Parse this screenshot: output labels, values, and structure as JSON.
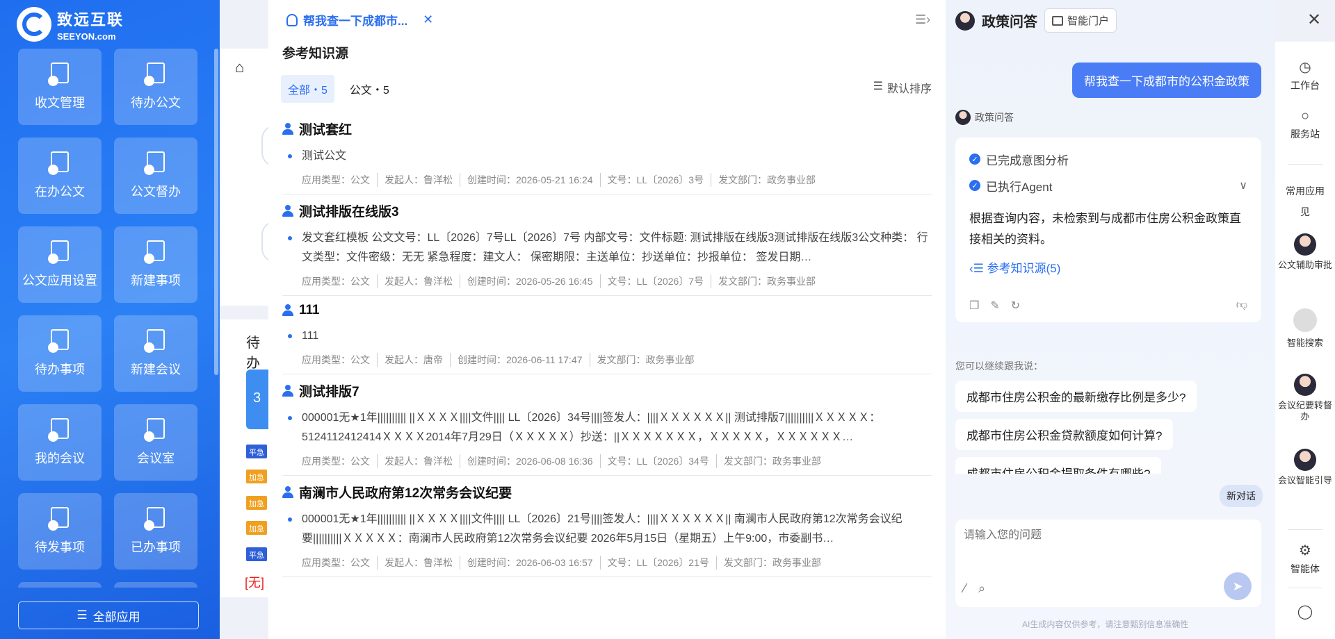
{
  "logo": {
    "cn": "致远互联",
    "en": "SEEYON.com"
  },
  "apps": [
    {
      "label": "收文管理",
      "icon": "inbox-doc-icon"
    },
    {
      "label": "待办公文",
      "icon": "pending-doc-icon"
    },
    {
      "label": "在办公文",
      "icon": "inprogress-doc-icon"
    },
    {
      "label": "公文督办",
      "icon": "supervise-doc-icon"
    },
    {
      "label": "公文应用设置",
      "icon": "doc-settings-icon"
    },
    {
      "label": "新建事项",
      "icon": "new-item-icon"
    },
    {
      "label": "待办事项",
      "icon": "todo-icon"
    },
    {
      "label": "新建会议",
      "icon": "new-meeting-icon"
    },
    {
      "label": "我的会议",
      "icon": "my-meeting-icon"
    },
    {
      "label": "会议室",
      "icon": "meeting-room-icon"
    },
    {
      "label": "待发事项",
      "icon": "to-send-icon"
    },
    {
      "label": "已办事项",
      "icon": "done-icon"
    },
    {
      "label": "",
      "icon": "more-app-icon"
    },
    {
      "label": "",
      "icon": "more-app-icon"
    }
  ],
  "all_apps_label": "全部应用",
  "main_peek": {
    "section_label": "待办",
    "count": "3",
    "tags": [
      "平急",
      "加急",
      "加急",
      "加急",
      "平急"
    ],
    "red_text": "[无]"
  },
  "ks": {
    "query": "帮我查一下成都市...",
    "title": "参考知识源",
    "tabs": [
      {
        "label": "全部・5"
      },
      {
        "label": "公文・5"
      }
    ],
    "sort_label": "默认排序",
    "items": [
      {
        "title": "测试套红",
        "body": "测试公文",
        "meta": [
          "应用类型：公文",
          "发起人：鲁洋松",
          "创建时间：2026-05-21 16:24",
          "文号：LL〔2026〕3号",
          "发文部门：政务事业部"
        ]
      },
      {
        "title": "测试排版在线版3",
        "body": "发文套红模板 公文文号：LL〔2026〕7号LL〔2026〕7号 内部文号：文件标题: 测试排版在线版3测试排版在线版3公文种类： 行文类型：文件密级：无无 紧急程度：建文人： 保密期限：主送单位：抄送单位：抄报单位： 签发日期…",
        "meta": [
          "应用类型：公文",
          "发起人：鲁洋松",
          "创建时间：2026-05-26 16:45",
          "文号：LL〔2026〕7号",
          "发文部门：政务事业部"
        ]
      },
      {
        "title": "111",
        "body": "111",
        "meta": [
          "应用类型：公文",
          "发起人：唐帝",
          "创建时间：2026-06-11 17:47",
          "发文部门：政务事业部"
        ]
      },
      {
        "title": "测试排版7",
        "body": "000001无★1年|||||||||| ||ＸＸＸＸ||||文件|||| LL〔2026〕34号||||签发人：||||ＸＸＸＸＸＸ|| 测试排版7||||||||||ＸＸＸＸＸ：5124112412414ＸＸＸＸ2014年7月29日（ＸＸＸＸＸ）抄送：||ＸＸＸＸＸＸＸ，ＸＸＸＸＸ，ＸＸＸＸＸＸ…",
        "meta": [
          "应用类型：公文",
          "发起人：鲁洋松",
          "创建时间：2026-06-08 16:36",
          "文号：LL〔2026〕34号",
          "发文部门：政务事业部"
        ]
      },
      {
        "title": "南澜市人民政府第12次常务会议纪要",
        "body": "000001无★1年|||||||||| ||ＸＸＸＸ||||文件|||| LL〔2026〕21号||||签发人：||||ＸＸＸＸＸＸ|| 南澜市人民政府第12次常务会议纪要||||||||||ＸＸＸＸＸ：南澜市人民政府第12次常务会议纪要 2026年5月15日（星期五）上午9:00，市委副书…",
        "meta": [
          "应用类型：公文",
          "发起人：鲁洋松",
          "创建时间：2026-06-03 16:57",
          "文号：LL〔2026〕21号",
          "发文部门：政务事业部"
        ]
      }
    ]
  },
  "chat": {
    "title": "政策问答",
    "portal_label": "智能门户",
    "user_message": "帮我查一下成都市的公积金政策",
    "bot_name": "政策问答",
    "steps": [
      "已完成意图分析",
      "已执行Agent"
    ],
    "answer": "根据查询内容，未检索到与成都市住房公积金政策直接相关的资料。",
    "ref_link": "参考知识源(5)",
    "followups_label": "您可以继续跟我说：",
    "followups": [
      "成都市住房公积金的最新缴存比例是多少?",
      "成都市住房公积金贷款额度如何计算?",
      "成都市住房公积金提取条件有哪些?"
    ],
    "new_chat_label": "新对话",
    "input_placeholder": "请输入您的问题",
    "disclaimer": "AI生成内容仅供参考，请注意甄别信息准确性"
  },
  "rail": {
    "workbench": "工作台",
    "service": "服务站",
    "common_apps": "常用应用",
    "common_apps_2": "见",
    "doc_assist": "公文辅助审批",
    "smart_search": "智能搜索",
    "minutes": "会议纪要转督办",
    "meeting_guide": "会议智能引导",
    "agent": "智能体"
  }
}
